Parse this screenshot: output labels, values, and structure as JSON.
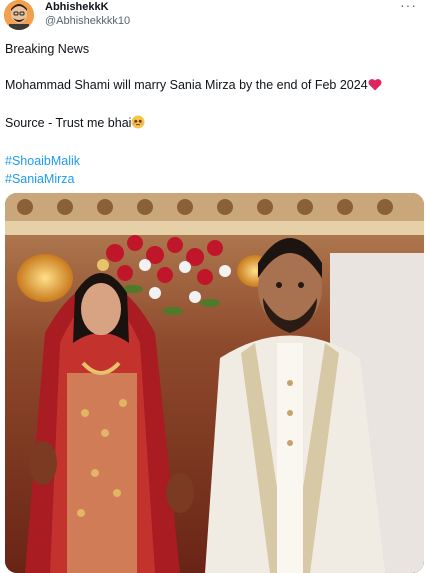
{
  "user": {
    "display_name": "AbhishekkK",
    "handle": "@Abhishekkkk10"
  },
  "icons": {
    "more": "more-icon",
    "heart": "red-heart-emoji",
    "face": "pleading-face-emoji"
  },
  "tweet": {
    "line1": "Breaking News",
    "line2": "Mohammad Shami will marry Sania Mirza by the end of Feb 2024",
    "line3": "Source - Trust me bhai",
    "hashtag1": "#ShoaibMalik",
    "hashtag2": "#SaniaMirza"
  },
  "colors": {
    "link": "#1d9bf0",
    "text": "#0f1419",
    "secondary": "#536471"
  }
}
